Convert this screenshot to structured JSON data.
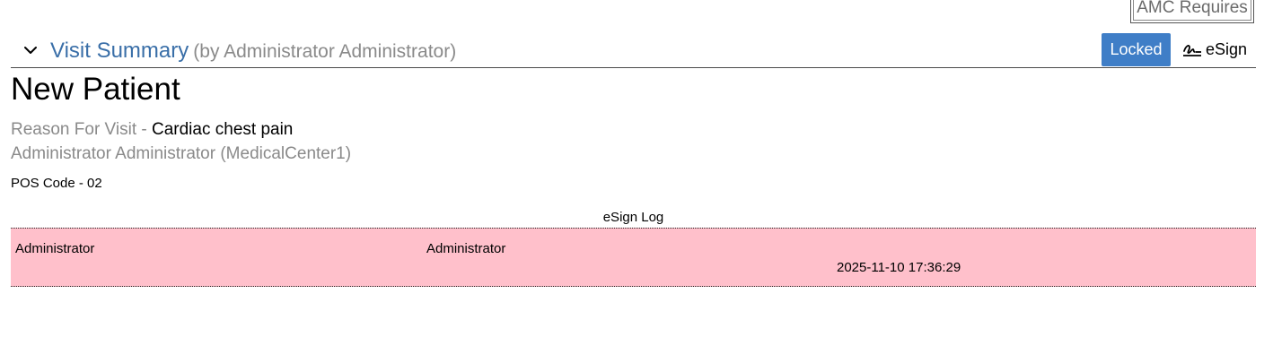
{
  "amc": {
    "label": "AMC Requires"
  },
  "header": {
    "title": "Visit Summary",
    "subtitle": "(by Administrator Administrator)",
    "locked_label": "Locked",
    "esign_label": "eSign"
  },
  "encounter": {
    "title": "New Patient",
    "reason_label": "Reason For Visit",
    "reason_separator": " - ",
    "reason_value": "Cardiac chest pain",
    "provider_line": "Administrator Administrator (MedicalCenter1)",
    "pos_line": "POS Code - 02"
  },
  "esign_log": {
    "title": "eSign Log",
    "rows": [
      {
        "user": "Administrator",
        "signer": "Administrator",
        "datetime": "2025-11-10 17:36:29"
      }
    ]
  },
  "colors": {
    "accent": "#3a6fa8",
    "locked_bg": "#3f7ec7",
    "log_bg": "#ffc0cb",
    "muted_text": "#8a8a8a"
  },
  "icons": {
    "collapse": "chevron-down-icon",
    "esign": "signature-icon"
  }
}
